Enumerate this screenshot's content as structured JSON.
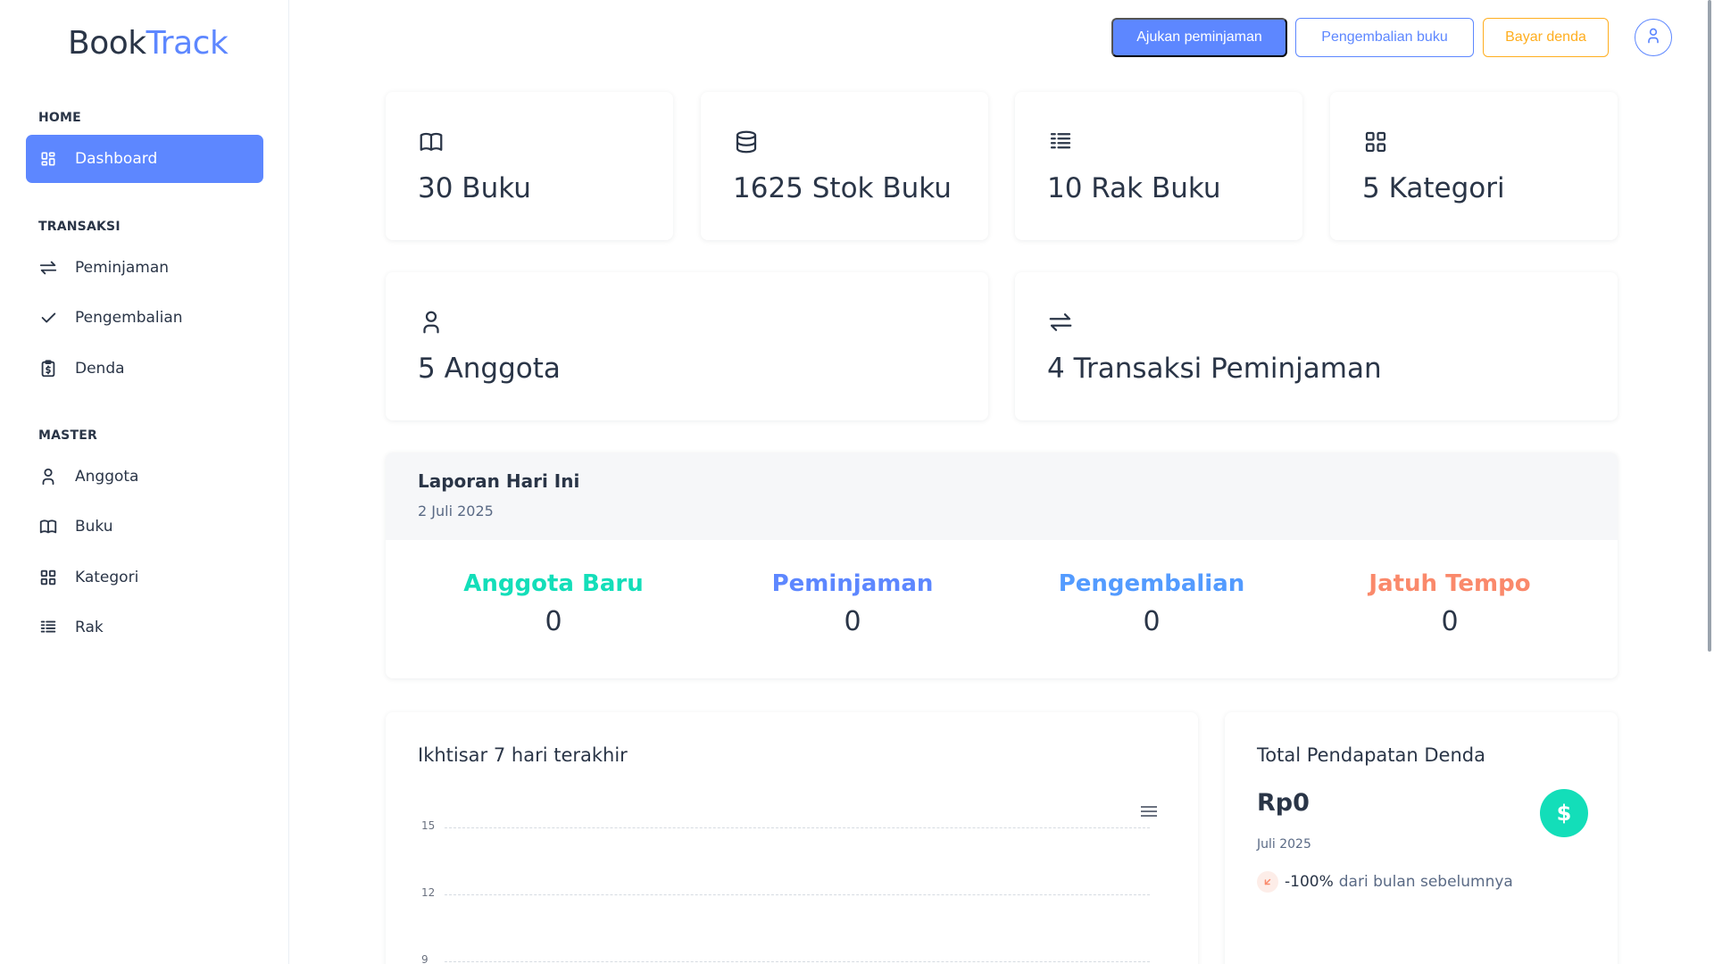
{
  "brand": {
    "part1": "Book",
    "part2": "Track"
  },
  "sidebar": {
    "sections": [
      {
        "label": "HOME"
      },
      {
        "label": "TRANSAKSI"
      },
      {
        "label": "MASTER"
      }
    ],
    "items": [
      {
        "label": "Dashboard",
        "icon": "dashboard-icon",
        "active": true
      },
      {
        "label": "Peminjaman",
        "icon": "arrows-exchange-icon"
      },
      {
        "label": "Pengembalian",
        "icon": "check-icon"
      },
      {
        "label": "Denda",
        "icon": "clipboard-dollar-icon"
      },
      {
        "label": "Anggota",
        "icon": "user-icon"
      },
      {
        "label": "Buku",
        "icon": "book-icon"
      },
      {
        "label": "Kategori",
        "icon": "grid-icon"
      },
      {
        "label": "Rak",
        "icon": "list-details-icon"
      }
    ]
  },
  "header": {
    "borrow_button": "Ajukan peminjaman",
    "return_button": "Pengembalian buku",
    "pay_fine_button": "Bayar denda"
  },
  "stats": [
    {
      "text": "30 Buku",
      "icon": "book-icon"
    },
    {
      "text": "1625 Stok Buku",
      "icon": "database-icon"
    },
    {
      "text": "10 Rak Buku",
      "icon": "list-details-icon"
    },
    {
      "text": "5 Kategori",
      "icon": "grid-icon"
    },
    {
      "text": "5 Anggota",
      "icon": "user-icon"
    },
    {
      "text": "4 Transaksi Peminjaman",
      "icon": "arrows-exchange-icon"
    }
  ],
  "report": {
    "title": "Laporan Hari Ini",
    "date": "2 Juli 2025",
    "metrics": [
      {
        "label": "Anggota Baru",
        "value": "0",
        "color": "#13deb9"
      },
      {
        "label": "Peminjaman",
        "value": "0",
        "color": "#5d87ff"
      },
      {
        "label": "Pengembalian",
        "value": "0",
        "color": "#539bff"
      },
      {
        "label": "Jatuh Tempo",
        "value": "0",
        "color": "#fa896b"
      }
    ]
  },
  "overview": {
    "title": "Ikhtisar 7 hari terakhir",
    "y_ticks": [
      "15",
      "12",
      "9"
    ]
  },
  "fines": {
    "title": "Total Pendapatan Denda",
    "amount": "Rp0",
    "period": "Juli 2025",
    "change": "-100%",
    "change_text": "dari bulan sebelumnya",
    "currency_symbol": "$"
  },
  "colors": {
    "primary": "#5d87ff",
    "warning": "#ffae1f",
    "success": "#13deb9",
    "danger": "#fa896b"
  }
}
